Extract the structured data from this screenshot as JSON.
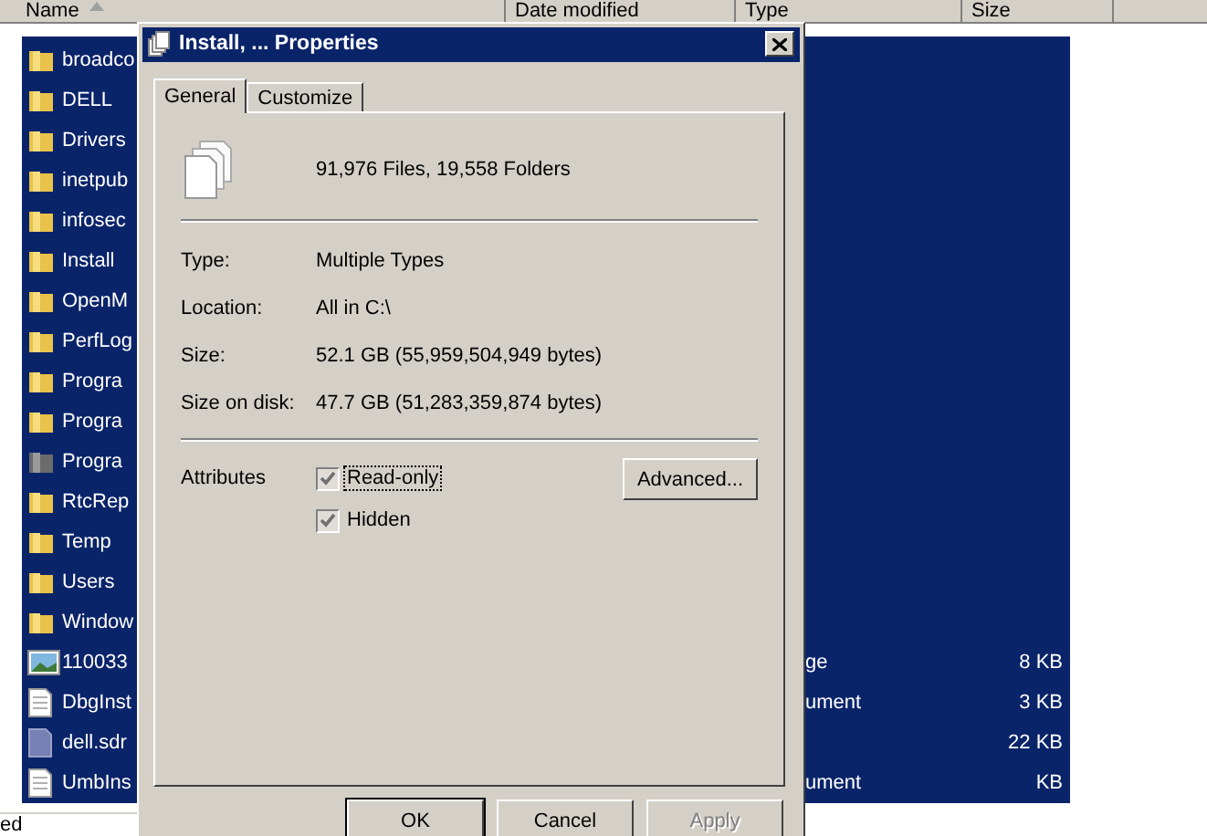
{
  "explorer": {
    "columns": [
      {
        "label": "Name",
        "sorted": true
      },
      {
        "label": "Date modified",
        "sorted": false
      },
      {
        "label": "Type",
        "sorted": false
      },
      {
        "label": "Size",
        "sorted": false
      }
    ],
    "rows": [
      {
        "kind": "folder",
        "name": "broadco",
        "type": "",
        "size": "",
        "selected": true
      },
      {
        "kind": "folder",
        "name": "DELL",
        "type": "",
        "size": "",
        "selected": true
      },
      {
        "kind": "folder",
        "name": "Drivers",
        "type": "",
        "size": "",
        "selected": true
      },
      {
        "kind": "folder",
        "name": "inetpub",
        "type": "",
        "size": "",
        "selected": true
      },
      {
        "kind": "folder",
        "name": "infosec",
        "type": "",
        "size": "",
        "selected": true
      },
      {
        "kind": "folder",
        "name": "Install",
        "type": "",
        "size": "",
        "selected": true
      },
      {
        "kind": "folder",
        "name": "OpenM",
        "type": "",
        "size": "",
        "selected": true
      },
      {
        "kind": "folder",
        "name": "PerfLog",
        "type": "",
        "size": "",
        "selected": true
      },
      {
        "kind": "folder",
        "name": "Progra",
        "type": "",
        "size": "",
        "selected": true
      },
      {
        "kind": "folder",
        "name": "Progra",
        "type": "",
        "size": "",
        "selected": true
      },
      {
        "kind": "system-folder",
        "name": "Progra",
        "type": "",
        "size": "",
        "selected": true
      },
      {
        "kind": "folder",
        "name": "RtcRep",
        "type": "",
        "size": "",
        "selected": true
      },
      {
        "kind": "folder",
        "name": "Temp",
        "type": "",
        "size": "",
        "selected": true
      },
      {
        "kind": "folder",
        "name": "Users",
        "type": "",
        "size": "",
        "selected": true
      },
      {
        "kind": "folder",
        "name": "Window",
        "type": "",
        "size": "",
        "selected": true
      },
      {
        "kind": "image",
        "name": "110033",
        "type": "ge",
        "size": "8 KB",
        "selected": true
      },
      {
        "kind": "document",
        "name": "DbgInst",
        "type": "ument",
        "size": "3 KB",
        "selected": true
      },
      {
        "kind": "file",
        "name": "dell.sdr",
        "type": "",
        "size": "22 KB",
        "selected": true
      },
      {
        "kind": "document",
        "name": "UmbIns",
        "type": "ument",
        "size": "KB",
        "selected": true
      }
    ],
    "status_bar": "ed"
  },
  "dialog": {
    "title": "Install, ... Properties",
    "tabs": [
      {
        "label": "General",
        "selected": true
      },
      {
        "label": "Customize",
        "selected": false
      }
    ],
    "summary": "91,976 Files, 19,558 Folders",
    "properties": [
      {
        "label": "Type:",
        "value": "Multiple Types"
      },
      {
        "label": "Location:",
        "value": "All in C:\\"
      },
      {
        "label": "Size:",
        "value": "52.1 GB (55,959,504,949 bytes)"
      },
      {
        "label": "Size on disk:",
        "value": "47.7 GB (51,283,359,874 bytes)"
      }
    ],
    "attributes_label": "Attributes",
    "attributes": [
      {
        "label": "Read-only",
        "checked": true,
        "focused": true
      },
      {
        "label": "Hidden",
        "checked": true,
        "focused": false
      }
    ],
    "advanced_button": "Advanced...",
    "buttons": [
      {
        "label": "OK",
        "disabled": false,
        "default": true
      },
      {
        "label": "Cancel",
        "disabled": false,
        "default": false
      },
      {
        "label": "Apply",
        "disabled": true,
        "default": false
      }
    ]
  }
}
